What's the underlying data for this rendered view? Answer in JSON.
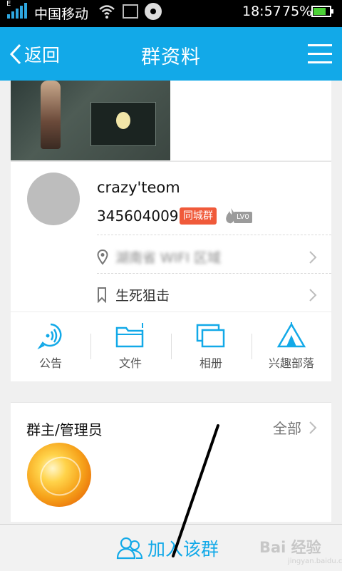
{
  "status_bar": {
    "carrier": "中国移动",
    "time": "18:57",
    "battery": "75%",
    "battery_level": 0.75,
    "network": "E",
    "icons": [
      "signal-icon",
      "wifi-icon",
      "image-icon",
      "disc-icon",
      "battery-icon"
    ]
  },
  "header": {
    "back_label": "返回",
    "title": "群资料",
    "menu_icon": "menu-icon",
    "background": "#12a9e8"
  },
  "group": {
    "name": "crazy'teom",
    "id": "345604009",
    "city_badge": "同城群",
    "level": "LV0",
    "location": "湖南省 WIFI 区域",
    "category": "生死狙击"
  },
  "actions": [
    {
      "label": "公告",
      "icon": "announcement-icon"
    },
    {
      "label": "文件",
      "icon": "folder-icon"
    },
    {
      "label": "相册",
      "icon": "album-icon"
    },
    {
      "label": "兴趣部落",
      "icon": "tent-icon"
    }
  ],
  "admins": {
    "title": "群主/管理员",
    "all_label": "全部"
  },
  "bottom": {
    "join_label": "加入该群",
    "watermark": "Bai 经验",
    "watermark_sub": "jingyan.baidu.com"
  },
  "colors": {
    "accent": "#12a9e8",
    "badge": "#f05a3a"
  }
}
